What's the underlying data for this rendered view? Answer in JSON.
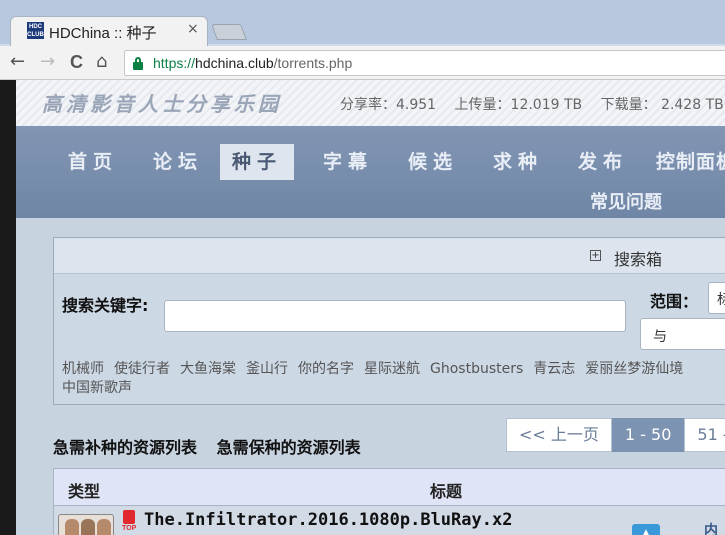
{
  "browser": {
    "tab_title": "HDChina :: 种子",
    "tab_close": "×",
    "favicon_text": "HDC CLUB",
    "url_scheme": "https://",
    "url_host": "hdchina.club",
    "url_path": "/torrents.php",
    "back": "←",
    "forward": "→",
    "reload": "C",
    "home": "⌂"
  },
  "header": {
    "logo": "高清影音人士分享乐园",
    "stats": {
      "ratio": "分享率：4.951",
      "uploaded": "上传量：12.019 TB",
      "downloaded": "下载量： 2.428 TB"
    }
  },
  "nav": {
    "items": [
      "首页",
      "论坛",
      "种子",
      "字幕",
      "候选",
      "求种",
      "发布",
      "控制面板"
    ],
    "active": "种子",
    "faq": "常见问题"
  },
  "search": {
    "title": "搜索箱",
    "keyword_label": "搜索关键字:",
    "keyword_value": "",
    "range_label": "范围：",
    "range_value": "标",
    "and_value": "与",
    "hot_keywords": [
      "机械师",
      "使徒行者",
      "大鱼海棠",
      "釜山行",
      "你的名字",
      "星际迷航",
      "Ghostbusters",
      "青云志",
      "爱丽丝梦游仙境",
      "中国新歌声"
    ]
  },
  "lists": {
    "need_seed": "急需补种的资源列表",
    "need_keep": "急需保种的资源列表"
  },
  "pager": {
    "prev": "<< 上一页",
    "current": "1 - 50",
    "next": "51 -"
  },
  "table": {
    "col_type": "类型",
    "col_title": "标题",
    "rows": [
      {
        "title": "The.Infiltrator.2016.1080p.BluRay.x2",
        "flag": "TOP",
        "side": "内"
      }
    ]
  },
  "colors": {
    "nav_bg": "#7e93b0",
    "page_bg": "#c8d3e0",
    "accent_green": "#0b8043"
  }
}
